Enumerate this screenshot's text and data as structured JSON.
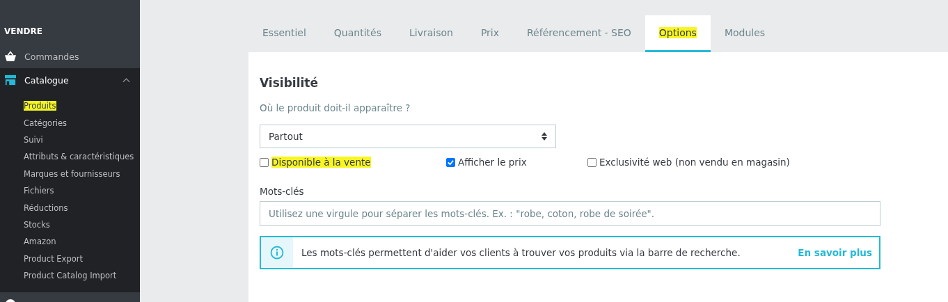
{
  "sidebar": {
    "section_title": "VENDRE",
    "items": [
      {
        "label": "Commandes",
        "kind": "link"
      },
      {
        "label": "Catalogue",
        "kind": "group",
        "expanded": true,
        "children": [
          {
            "label": "Produits",
            "highlighted": true
          },
          {
            "label": "Catégories",
            "highlighted": false
          },
          {
            "label": "Suivi",
            "highlighted": false
          },
          {
            "label": "Attributs & caractéristiques",
            "highlighted": false
          },
          {
            "label": "Marques et fournisseurs",
            "highlighted": false
          },
          {
            "label": "Fichiers",
            "highlighted": false
          },
          {
            "label": "Réductions",
            "highlighted": false
          },
          {
            "label": "Stocks",
            "highlighted": false
          },
          {
            "label": "Amazon",
            "highlighted": false
          },
          {
            "label": "Product Export",
            "highlighted": false
          },
          {
            "label": "Product Catalog Import",
            "highlighted": false
          }
        ]
      }
    ]
  },
  "tabs": [
    {
      "label": "Essentiel",
      "selected": false,
      "highlighted": false
    },
    {
      "label": "Quantités",
      "selected": false,
      "highlighted": false
    },
    {
      "label": "Livraison",
      "selected": false,
      "highlighted": false
    },
    {
      "label": "Prix",
      "selected": false,
      "highlighted": false
    },
    {
      "label": "Référencement - SEO",
      "selected": false,
      "highlighted": false
    },
    {
      "label": "Options",
      "selected": true,
      "highlighted": true
    },
    {
      "label": "Modules",
      "selected": false,
      "highlighted": false
    }
  ],
  "visibility": {
    "title": "Visibilité",
    "question": "Où le produit doit-il apparaître ?",
    "select_value": "Partout",
    "checkboxes": [
      {
        "label": "Disponible à la vente",
        "checked": false,
        "highlighted": true
      },
      {
        "label": "Afficher le prix",
        "checked": true,
        "highlighted": false
      },
      {
        "label": "Exclusivité web (non vendu en magasin)",
        "checked": false,
        "highlighted": false
      }
    ]
  },
  "keywords": {
    "label": "Mots-clés",
    "placeholder": "Utilisez une virgule pour séparer les mots-clés. Ex. : \"robe, coton, robe de soirée\"."
  },
  "info": {
    "text": "Les mots-clés permettent d'aider vos clients à trouver vos produits via la barre de recherche.",
    "link": "En savoir plus"
  }
}
